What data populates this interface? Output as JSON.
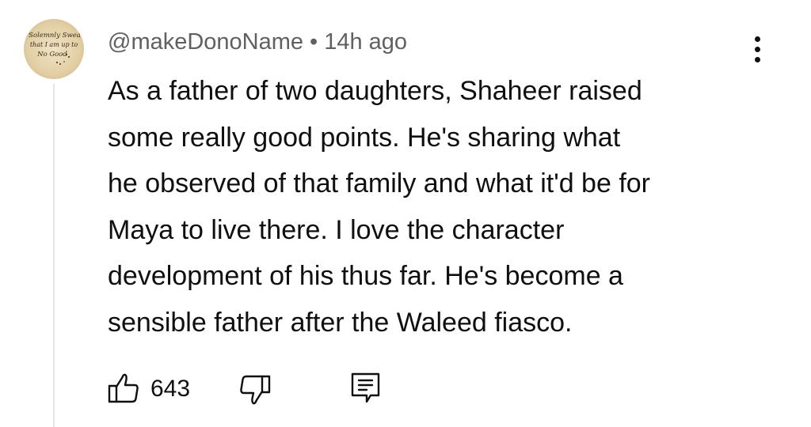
{
  "comment": {
    "author": "@makeDonoName",
    "separator": "•",
    "timestamp": "14h ago",
    "text_lines": [
      "As a father of two daughters, Shaheer raised",
      "some really good points. He's sharing what",
      "he observed of that family and what it'd be for",
      "Maya to live there. I love the character",
      "development of his thus far. He's become a",
      "sensible father after the Waleed fiasco."
    ],
    "like_count": "643",
    "avatar_text": "I Solemnly Swear that I am up to No Good"
  },
  "icons": {
    "avatar": "avatar-image",
    "menu": "more-vertical-icon",
    "like": "thumbs-up-icon",
    "dislike": "thumbs-down-icon",
    "reply": "comment-reply-icon"
  },
  "colors": {
    "text": "#0f0f0f",
    "meta": "#606060",
    "thread_line": "#e5e5e5",
    "background": "#ffffff"
  }
}
